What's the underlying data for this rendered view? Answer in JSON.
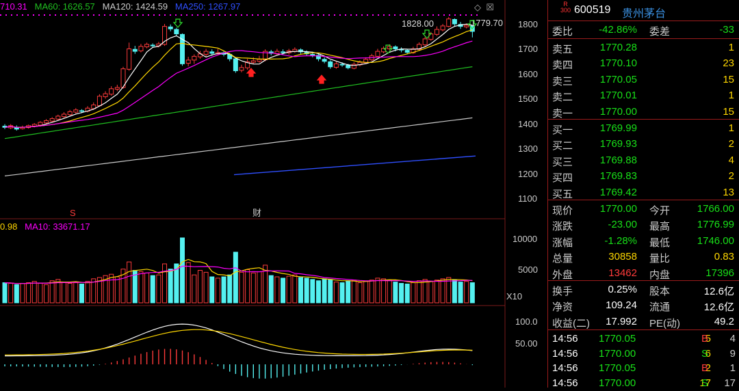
{
  "chart": {
    "ma_header": [
      {
        "label": "710.31",
        "color": "#ff00ff"
      },
      {
        "label": "MA60: 1626.57",
        "color": "#20c020"
      },
      {
        "label": "MA120: 1424.59",
        "color": "#cccccc"
      },
      {
        "label": "MA250: 1267.97",
        "color": "#2f4fff"
      }
    ],
    "price_axis": [
      "1800",
      "1700",
      "1600",
      "1500",
      "1400",
      "1300",
      "1200",
      "1100"
    ],
    "high_label": "1828.00",
    "last_label": "1779.70",
    "marker_s": "S",
    "marker_cai": "财",
    "vol_header": [
      {
        "label": "0.98",
        "color": "#ffd700"
      },
      {
        "label": "MA10: 33671.17",
        "color": "#ff00ff"
      }
    ],
    "vol_axis": [
      "10000",
      "5000"
    ],
    "vol_unit": "X10",
    "ind_axis": [
      "100.0",
      "50.00"
    ],
    "colors": {
      "up": "#ff3b3b",
      "down": "#54f0f0",
      "ma5": "#ffffff",
      "ma10": "#ffd700",
      "ma20": "#ff00ff",
      "ma60": "#20c020",
      "ma120": "#cccccc",
      "ma250": "#2f4fff"
    }
  },
  "quote": {
    "code": "600519",
    "name": "贵州茅台",
    "badge_top": "R",
    "badge_bottom": "300",
    "weibi_label": "委比",
    "weibi_value": "-42.86%",
    "weicha_label": "委差",
    "weicha_value": "-33",
    "asks": [
      {
        "label": "卖五",
        "price": "1770.28",
        "vol": "1"
      },
      {
        "label": "卖四",
        "price": "1770.10",
        "vol": "23"
      },
      {
        "label": "卖三",
        "price": "1770.05",
        "vol": "15"
      },
      {
        "label": "卖二",
        "price": "1770.01",
        "vol": "1"
      },
      {
        "label": "卖一",
        "price": "1770.00",
        "vol": "15"
      }
    ],
    "bids": [
      {
        "label": "买一",
        "price": "1769.99",
        "vol": "1"
      },
      {
        "label": "买二",
        "price": "1769.93",
        "vol": "2"
      },
      {
        "label": "买三",
        "price": "1769.88",
        "vol": "4"
      },
      {
        "label": "买四",
        "price": "1769.83",
        "vol": "2"
      },
      {
        "label": "买五",
        "price": "1769.42",
        "vol": "13"
      }
    ],
    "stats": [
      {
        "l1": "现价",
        "v1": "1770.00",
        "c1": "green",
        "l2": "今开",
        "v2": "1766.00",
        "c2": "green"
      },
      {
        "l1": "涨跌",
        "v1": "-23.00",
        "c1": "green",
        "l2": "最高",
        "v2": "1776.99",
        "c2": "green"
      },
      {
        "l1": "涨幅",
        "v1": "-1.28%",
        "c1": "green",
        "l2": "最低",
        "v2": "1746.00",
        "c2": "green"
      },
      {
        "l1": "总量",
        "v1": "30858",
        "c1": "yellow",
        "l2": "量比",
        "v2": "0.83",
        "c2": "yellow"
      },
      {
        "l1": "外盘",
        "v1": "13462",
        "c1": "red",
        "l2": "内盘",
        "v2": "17396",
        "c2": "green"
      }
    ],
    "stats2": [
      {
        "l1": "换手",
        "v1": "0.25%",
        "l2": "股本",
        "v2": "12.6亿"
      },
      {
        "l1": "净资",
        "v1": "109.24",
        "l2": "流通",
        "v2": "12.6亿"
      },
      {
        "l1": "收益(二)",
        "v1": "17.992",
        "l2": "PE(动)",
        "v2": "49.2"
      }
    ],
    "ticks": [
      {
        "time": "14:56",
        "price": "1770.05",
        "vol": "5",
        "side": "B",
        "n": "4"
      },
      {
        "time": "14:56",
        "price": "1770.00",
        "vol": "6",
        "side": "S",
        "n": "9"
      },
      {
        "time": "14:56",
        "price": "1770.05",
        "vol": "2",
        "side": "B",
        "n": "1"
      },
      {
        "time": "14:56",
        "price": "1770.00",
        "vol": "17",
        "side": "S",
        "n": "17"
      }
    ]
  }
}
